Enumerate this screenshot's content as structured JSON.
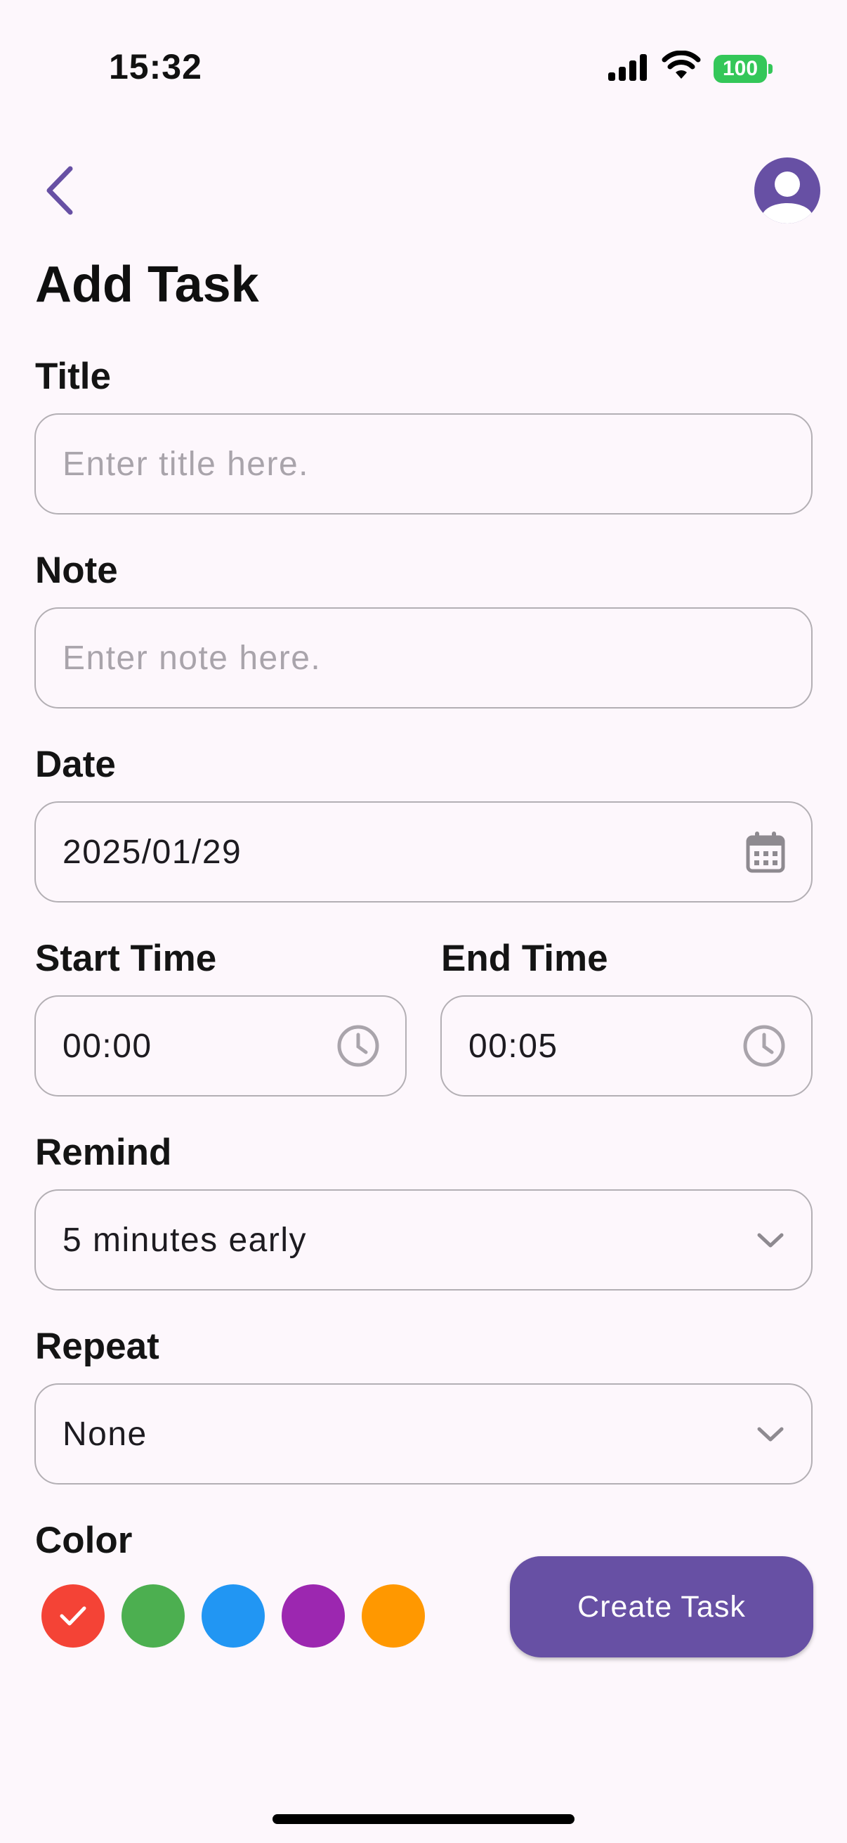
{
  "status_bar": {
    "time": "15:32",
    "battery": "100"
  },
  "header": {
    "title": "Add Task",
    "back_icon": "chevron-left-icon",
    "profile_icon": "person-avatar-icon"
  },
  "form": {
    "title": {
      "label": "Title",
      "placeholder": "Enter title here."
    },
    "note": {
      "label": "Note",
      "placeholder": "Enter note here."
    },
    "date": {
      "label": "Date",
      "value": "2025/01/29",
      "icon": "calendar-icon"
    },
    "start_time": {
      "label": "Start Time",
      "value": "00:00",
      "icon": "clock-icon"
    },
    "end_time": {
      "label": "End Time",
      "value": "00:05",
      "icon": "clock-icon"
    },
    "remind": {
      "label": "Remind",
      "value": "5 minutes early",
      "icon": "chevron-down-icon"
    },
    "repeat": {
      "label": "Repeat",
      "value": "None",
      "icon": "chevron-down-icon"
    },
    "color": {
      "label": "Color",
      "options": [
        "#f44336",
        "#4caf50",
        "#2196f3",
        "#9c27b0",
        "#ff9800"
      ],
      "selected_index": 0
    }
  },
  "actions": {
    "create_label": "Create Task"
  },
  "theme": {
    "accent": "#6750a4",
    "background": "#fdf7fc"
  }
}
